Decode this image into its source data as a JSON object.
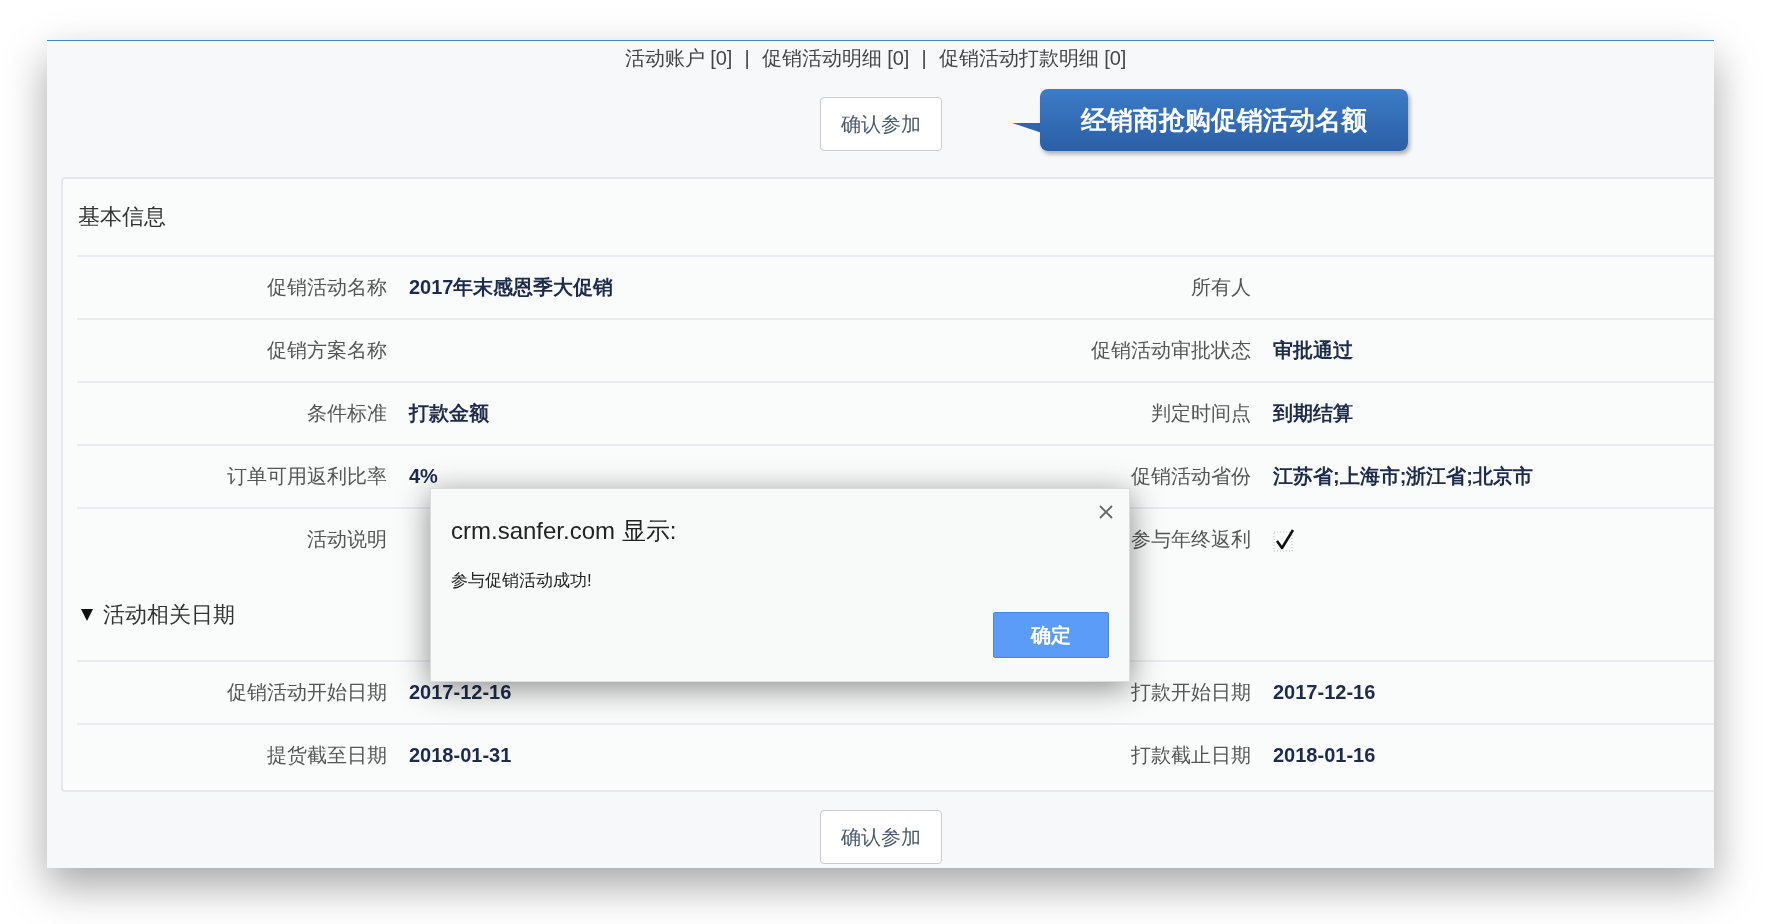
{
  "top_links": [
    "活动账户 [0]",
    "促销活动明细 [0]",
    "促销活动打款明细 [0]"
  ],
  "link_separator": "|",
  "top_button": "确认参加",
  "callout": "经销商抢购促销活动名额",
  "section_title": "基本信息",
  "rows": [
    {
      "left": {
        "label": "促销活动名称",
        "value": "2017年末感恩季大促销"
      },
      "right": {
        "label": "所有人"
      }
    },
    {
      "left": {
        "label": "促销方案名称"
      },
      "right": {
        "label": "促销活动审批状态",
        "value": "审批通过"
      }
    },
    {
      "left": {
        "label": "条件标准",
        "value": "打款金额"
      },
      "right": {
        "label": "判定时间点",
        "value": "到期结算"
      }
    },
    {
      "left": {
        "label": "订单可用返利比率",
        "value": "4%"
      },
      "right": {
        "label": "促销活动省份",
        "value": "江苏省;上海市;浙江省;北京市"
      }
    },
    {
      "left": {
        "label": "活动说明"
      },
      "right": {
        "label": "参与年终返利",
        "kind": "check",
        "checked": true
      }
    }
  ],
  "dates_section": {
    "title": "活动相关日期",
    "expanded": true,
    "rows": [
      {
        "left": {
          "label": "促销活动开始日期",
          "value": "2017-12-16"
        },
        "right": {
          "label": "打款开始日期",
          "value": "2017-12-16"
        }
      },
      {
        "left": {
          "label": "提货截至日期",
          "value": "2018-01-31"
        },
        "right": {
          "label": "打款截止日期",
          "value": "2018-01-16"
        }
      }
    ]
  },
  "bottom_button": "确认参加",
  "dialog": {
    "title": "crm.sanfer.com 显示:",
    "message": "参与促销活动成功!",
    "ok_button": "确定"
  }
}
